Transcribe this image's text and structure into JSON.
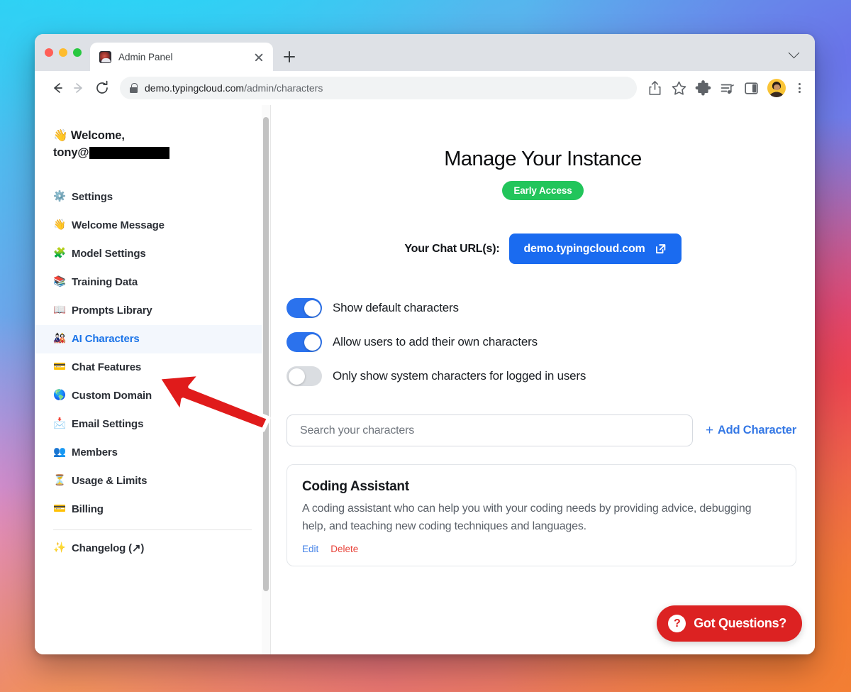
{
  "browser": {
    "tab": {
      "title": "Admin Panel",
      "favicon": "brain-favicon",
      "close_label": "×"
    },
    "new_tab_label": "+",
    "tab_list_chevron": "chevron-down-icon",
    "address": {
      "scheme_icon": "lock-icon",
      "host": "demo.typingcloud.com",
      "path": "/admin/characters"
    },
    "toolbar_icons": [
      "back-arrow-icon",
      "forward-arrow-icon",
      "reload-icon",
      "share-icon",
      "bookmark-star-icon",
      "extensions-puzzle-icon",
      "media-playlist-icon",
      "side-panel-icon",
      "profile-avatar",
      "three-dot-menu-icon"
    ]
  },
  "sidebar": {
    "welcome_line1": "👋 Welcome,",
    "welcome_user_prefix": "tony@",
    "welcome_user_redacted": true,
    "items": [
      {
        "emoji": "⚙️",
        "label": "Settings",
        "active": false
      },
      {
        "emoji": "👋",
        "label": "Welcome Message",
        "active": false
      },
      {
        "emoji": "🧩",
        "label": "Model Settings",
        "active": false
      },
      {
        "emoji": "📚",
        "label": "Training Data",
        "active": false
      },
      {
        "emoji": "📖",
        "label": "Prompts Library",
        "active": false
      },
      {
        "emoji": "🎎",
        "label": "AI Characters",
        "active": true
      },
      {
        "emoji": "💳",
        "label": "Chat Features",
        "active": false
      },
      {
        "emoji": "🌎",
        "label": "Custom Domain",
        "active": false
      },
      {
        "emoji": "📩",
        "label": "Email Settings",
        "active": false
      },
      {
        "emoji": "👥",
        "label": "Members",
        "active": false
      },
      {
        "emoji": "⏳",
        "label": "Usage & Limits",
        "active": false
      },
      {
        "emoji": "💳",
        "label": "Billing",
        "active": false
      }
    ],
    "footer_item": {
      "emoji": "✨",
      "label": "Changelog (↗)"
    }
  },
  "main": {
    "title": "Manage Your Instance",
    "badge": "Early Access",
    "badge_color": "#22c55b",
    "chat_url_label": "Your Chat URL(s):",
    "chat_url_button": "demo.typingcloud.com",
    "chat_url_button_color": "#1a6bf0",
    "toggles": [
      {
        "label": "Show default characters",
        "on": true
      },
      {
        "label": "Allow users to add their own characters",
        "on": true
      },
      {
        "label": "Only show system characters for logged in users",
        "on": false
      }
    ],
    "search_placeholder": "Search your characters",
    "search_value": "",
    "add_character_label": "Add Character",
    "add_character_plus": "+",
    "characters": [
      {
        "name": "Coding Assistant",
        "description": "A coding assistant who can help you with your coding needs by providing advice, debugging help, and teaching new coding techniques and languages.",
        "edit_label": "Edit",
        "delete_label": "Delete"
      }
    ],
    "help_button": {
      "label": "Got Questions?",
      "icon_glyph": "?",
      "color": "#dc2222"
    }
  },
  "annotation": {
    "arrow": "red-arrow-pointing-to-ai-characters"
  }
}
